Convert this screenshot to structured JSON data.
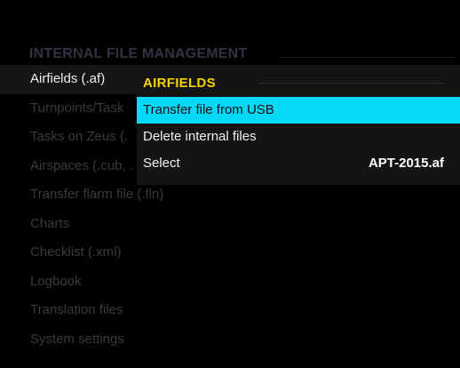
{
  "section": {
    "title": "INTERNAL FILE MANAGEMENT"
  },
  "menu": {
    "items": [
      {
        "label": "Airfields (.af)"
      },
      {
        "label": "Turnpoints/Task"
      },
      {
        "label": "Tasks on Zeus (."
      },
      {
        "label": "Airspaces (.cub, ."
      },
      {
        "label": "Transfer flarm file (.fln)"
      },
      {
        "label": "Charts"
      },
      {
        "label": "Checklist (.xml)"
      },
      {
        "label": "Logbook"
      },
      {
        "label": "Translation files"
      },
      {
        "label": "System settings"
      }
    ]
  },
  "popup": {
    "title": "AIRFIELDS",
    "options": [
      {
        "label": "Transfer file from USB"
      },
      {
        "label": "Delete internal files"
      },
      {
        "label": "Select",
        "value": "APT-2015.af"
      }
    ]
  },
  "colors": {
    "background": "#000000",
    "accent_title": "#f5d100",
    "highlight": "#08d8f8",
    "dim_text": "#3a3a3a"
  }
}
